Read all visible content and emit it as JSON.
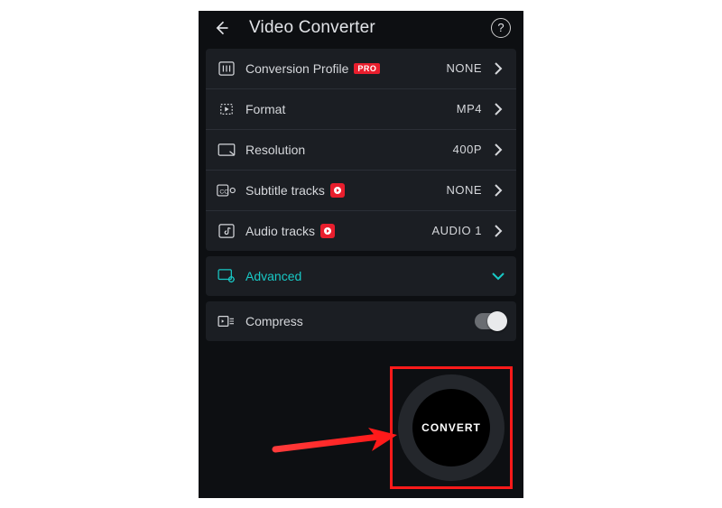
{
  "header": {
    "title": "Video Converter"
  },
  "settings": {
    "profile": {
      "label": "Conversion Profile",
      "value": "NONE",
      "badge": "PRO"
    },
    "format": {
      "label": "Format",
      "value": "MP4"
    },
    "resolution": {
      "label": "Resolution",
      "value": "400P"
    },
    "subtitle": {
      "label": "Subtitle tracks",
      "value": "NONE"
    },
    "audio": {
      "label": "Audio tracks",
      "value": "AUDIO 1"
    }
  },
  "advanced": {
    "label": "Advanced"
  },
  "compress": {
    "label": "Compress",
    "enabled": false
  },
  "convert": {
    "label": "CONVERT"
  }
}
